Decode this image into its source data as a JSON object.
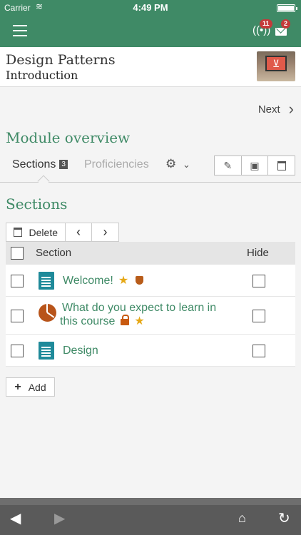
{
  "status_bar": {
    "carrier": "Carrier",
    "time": "4:49 PM"
  },
  "header": {
    "notifications_count": "11",
    "messages_count": "2"
  },
  "course": {
    "title": "Design Patterns",
    "subtitle": "Introduction"
  },
  "nav": {
    "next_label": "Next"
  },
  "module": {
    "heading": "Module overview"
  },
  "tabs": {
    "sections_label": "Sections",
    "sections_count": "3",
    "proficiencies_label": "Proficiencies"
  },
  "sections": {
    "heading": "Sections",
    "delete_label": "Delete",
    "columns": {
      "section": "Section",
      "hide": "Hide"
    },
    "items": [
      {
        "label": "Welcome!",
        "icon": "document-icon"
      },
      {
        "label_line1": "What do you expect to learn in",
        "label_line2": "this course",
        "icon": "pie-chart-icon"
      },
      {
        "label": "Design",
        "icon": "document-icon"
      }
    ],
    "add_label": "Add"
  },
  "colors": {
    "brand_green": "#3f8a66",
    "doc_teal": "#1f8a9a",
    "accent_orange": "#b8541a",
    "star_gold": "#e6a817",
    "badge_red": "#c43a3a"
  }
}
